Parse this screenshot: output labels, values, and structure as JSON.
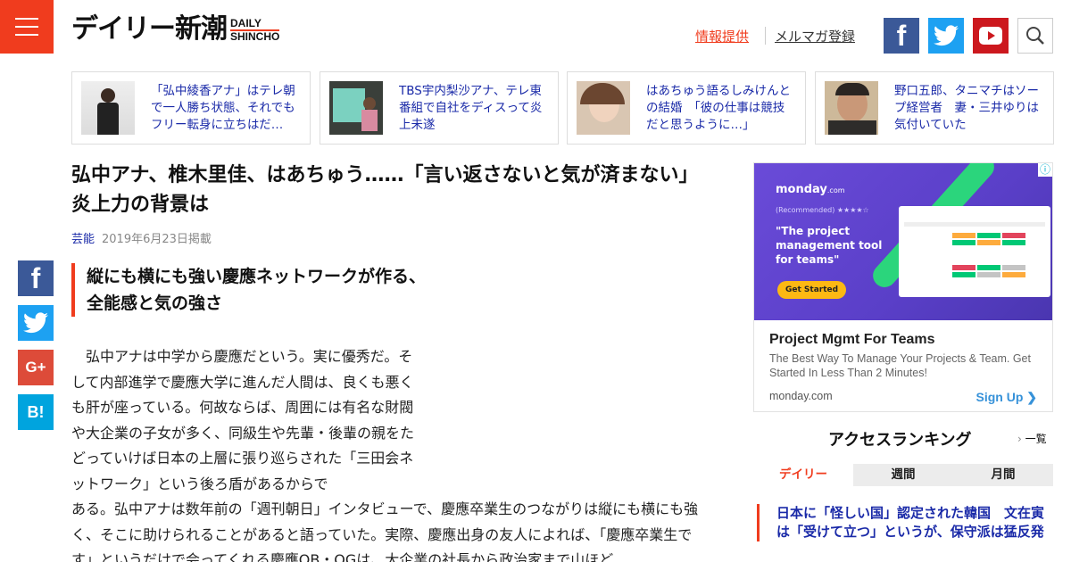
{
  "header": {
    "logo_jp": "デイリー新潮",
    "logo_en_line1": "DAILY",
    "logo_en_line2": "SHINCHO",
    "link_info": "情報提供",
    "link_mail": "メルマガ登録",
    "icons": [
      "menu-icon",
      "facebook-icon",
      "twitter-icon",
      "youtube-icon",
      "search-icon"
    ],
    "accent_color": "#f03c1e"
  },
  "related": [
    {
      "text": "「弘中綾香アナ」はテレ朝で一人勝ち状態、それでもフリー転身に立ちはだ…"
    },
    {
      "text": "TBS宇内梨沙アナ、テレ東番組で自社をディスって炎上未遂"
    },
    {
      "text": "はあちゅう語るしみけんとの結婚　「彼の仕事は競技だと思うように…」"
    },
    {
      "text": "野口五郎、タニマチはソープ経営者　妻・三井ゆりは気付いていた"
    }
  ],
  "article": {
    "title": "弘中アナ、椎木里佳、はあちゅう……「言い返さないと気が済まない」炎上力の背景は",
    "category": "芸能",
    "date": "2019年6月23日掲載",
    "subhead": "縦にも横にも強い慶應ネットワークが作る、全能感と気の強さ",
    "body_narrow": "　弘中アナは中学から慶應だという。実に優秀だ。そして内部進学で慶應大学に進んだ人間は、良くも悪くも肝が座っている。何故ならば、周囲には有名な財閥や大企業の子女が多く、同級生や先輩・後輩の親をたどっていけば日本の上層に張り巡らされた「三田会ネットワーク」という後ろ盾があるからで",
    "body_wide": "ある。弘中アナは数年前の「週刊朝日」インタビューで、慶應卒業生のつながりは縦にも横にも強く、そこに助けられることがあると語っていた。実際、慶應出身の友人によれば、「慶應卒業生です」というだけで会ってくれる慶應OB・OGは、大企業の社長から政治家まで山ほど"
  },
  "share": {
    "icons": [
      "facebook-icon",
      "twitter-icon",
      "google-plus-icon",
      "hatena-bookmark-icon"
    ],
    "gp_label": "G+",
    "hb_label": "B!"
  },
  "ad": {
    "brand": "monday",
    "brand_suffix": ".com",
    "recommended": "(Recommended) ★★★★☆",
    "headline": "\"The project management tool for teams\"",
    "cta": "Get Started",
    "title": "Project Mgmt For Teams",
    "desc": "The Best Way To Manage Your Projects & Team. Get Started In Less Than 2 Minutes!",
    "domain": "monday.com",
    "signup": "Sign Up ❯"
  },
  "ranking": {
    "title": "アクセスランキング",
    "more": "一覧",
    "tabs": [
      "デイリー",
      "週間",
      "月間"
    ],
    "active_tab": 0,
    "first_item": "日本に「怪しい国」認定された韓国　文在寅は「受けて立つ」というが、保守派は猛反発"
  }
}
